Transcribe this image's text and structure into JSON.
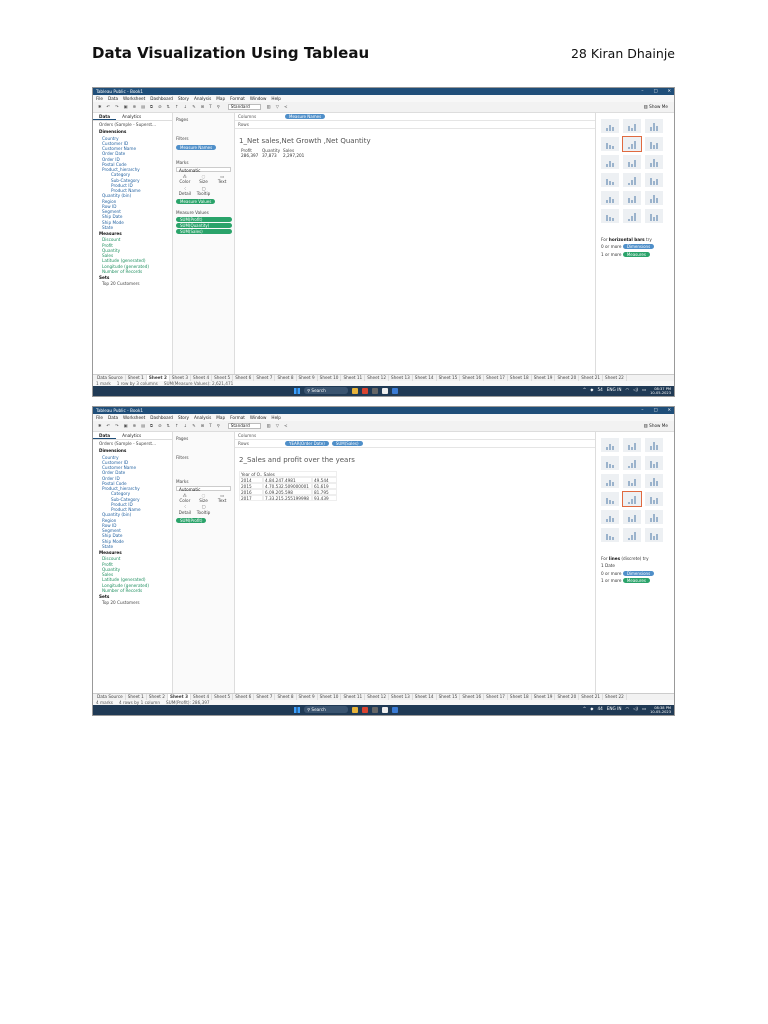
{
  "document": {
    "title": "Data Visualization Using Tableau",
    "author": "28 Kiran Dhainje"
  },
  "common": {
    "window_title": "Tableau Public - Book1",
    "window_controls": [
      "–",
      "□",
      "✕"
    ],
    "menu": [
      "File",
      "Data",
      "Worksheet",
      "Dashboard",
      "Story",
      "Analysis",
      "Map",
      "Format",
      "Window",
      "Help"
    ],
    "toolbar_fit": "Standard",
    "show_me": "Show Me",
    "pane_tabs": [
      "Data",
      "Analytics"
    ],
    "datasource": "Orders (Sample - Superst...",
    "dimensions_header": "Dimensions",
    "dimensions": [
      "Country",
      "Customer ID",
      "Customer Name",
      "Order Date",
      "Order ID",
      "Postal Code",
      "Product_hierarchy",
      "Category",
      "Sub-Category",
      "Product ID",
      "Product Name",
      "Quantity (bin)",
      "Region",
      "Row ID",
      "Segment",
      "Ship Date",
      "Ship Mode",
      "State"
    ],
    "measures_header": "Measures",
    "measures": [
      "Discount",
      "Profit",
      "Quantity",
      "Sales",
      "Latitude (generated)",
      "Longitude (generated)",
      "Number of Records"
    ],
    "sets_header": "Sets",
    "sets": [
      "Top 20 Customers"
    ],
    "shelf_pages": "Pages",
    "shelf_filters": "Filters",
    "shelf_marks": "Marks",
    "marks_type": "Automatic",
    "mark_buttons": [
      "Color",
      "Size",
      "Text",
      "Detail",
      "Tooltip"
    ],
    "shelf_columns": "Columns",
    "shelf_rows": "Rows",
    "tabs": [
      "Data Source",
      "Sheet 1",
      "Sheet 2",
      "Sheet 3",
      "Sheet 4",
      "Sheet 5",
      "Sheet 6",
      "Sheet 7",
      "Sheet 8",
      "Sheet 9",
      "Sheet 10",
      "Sheet 11",
      "Sheet 12",
      "Sheet 13",
      "Sheet 14",
      "Sheet 15",
      "Sheet 16",
      "Sheet 17",
      "Sheet 18",
      "Sheet 19",
      "Sheet 20",
      "Sheet 21",
      "Sheet 22"
    ],
    "taskbar_search": "Search",
    "tray_lang": "ENG IN",
    "tray_date": "10-05-2023"
  },
  "shot1": {
    "filters_pill": "Measure Names",
    "marks_pill": "Measure Values",
    "columns_pill": "Measure Names",
    "measure_values_header": "Measure Values",
    "measure_values": [
      "SUM(Profit)",
      "SUM(Quantity)",
      "SUM(Sales)"
    ],
    "sheet_title": "1_Net sales,Net Growth ,Net Quantity",
    "table_headers": [
      "Profit",
      "Quantity",
      "Sales"
    ],
    "table_values": [
      "286,397",
      "37,873",
      "2,297,201"
    ],
    "showme_hint_prefix": "For",
    "showme_hint_bold": "horizontal bars",
    "showme_hint_suffix": "try",
    "showme_req1": "0 or more",
    "showme_req1_pill": "Dimensions",
    "showme_req2": "1 or more",
    "showme_req2_pill": "Measures",
    "active_tab_index": 2,
    "status": [
      "1 mark",
      "1 row by 3 columns",
      "SUM(Measure Values): 2,621,471"
    ],
    "time": "08:37 PM",
    "tray_wifi": "54"
  },
  "shot2": {
    "marks_pill": "SUM(Profit)",
    "rows_pills": [
      "YEAR(Order Date)",
      "SUM(Sales)"
    ],
    "sheet_title": "2_Sales and profit over the years",
    "table_header": "Year of O.. Sales",
    "table_rows": [
      [
        "2014",
        "4,84,247.4981",
        "49,544"
      ],
      [
        "2015",
        "4,70,532.509000001",
        "61,619"
      ],
      [
        "2016",
        "6,09,205.598",
        "81,795"
      ],
      [
        "2017",
        "7,33,215.255199998",
        "93,439"
      ]
    ],
    "showme_hint_prefix": "For",
    "showme_hint_bold": "lines",
    "showme_hint_suffix": "(discrete) try",
    "showme_req0": "1 Date",
    "showme_req1": "0 or more",
    "showme_req1_pill": "Dimensions",
    "showme_req2": "1 or more",
    "showme_req2_pill": "Measures",
    "active_tab_index": 3,
    "status": [
      "4 marks",
      "4 rows by 1 column",
      "SUM(Profit): 286,397"
    ],
    "time": "08:38 PM",
    "tray_wifi": "44"
  }
}
